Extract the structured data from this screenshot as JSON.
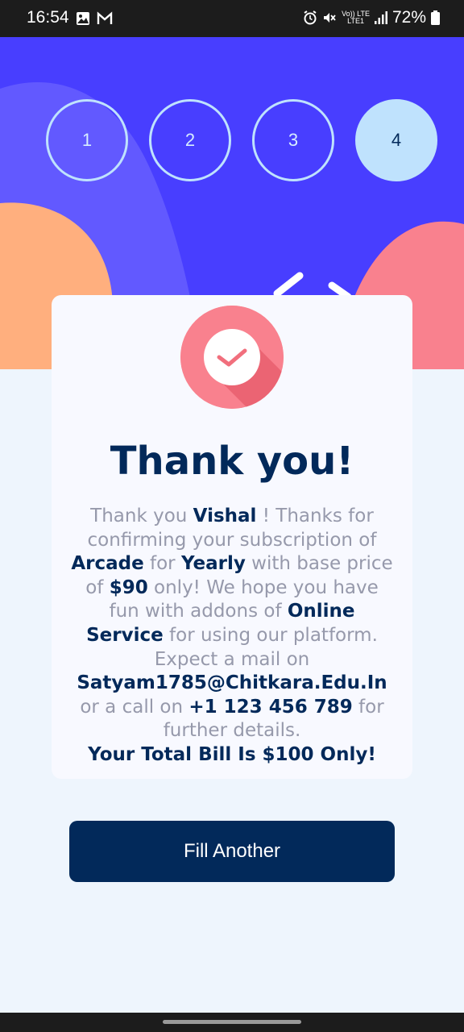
{
  "status_bar": {
    "time": "16:54",
    "battery": "72%",
    "network_top": "Vo)) LTE",
    "network_bottom": "LTE1",
    "icons": [
      "image-icon",
      "gmail-icon",
      "alarm-icon",
      "mute-icon",
      "signal-icon",
      "battery-icon"
    ]
  },
  "steps": [
    {
      "label": "1",
      "active": false
    },
    {
      "label": "2",
      "active": false
    },
    {
      "label": "3",
      "active": false
    },
    {
      "label": "4",
      "active": true
    }
  ],
  "card": {
    "title": "Thank you!",
    "message": {
      "p1": "Thank you ",
      "name": "Vishal",
      "p2": " ! Thanks for confirming your subscription of ",
      "plan": "Arcade",
      "p3": " for ",
      "billing": "Yearly",
      "p4": " with base price of ",
      "price": "$90",
      "p5": " only! We hope you have fun with addons of ",
      "addons": "Online Service",
      "p6": " for using our platform.",
      "p7": "Expect a mail on ",
      "email": "Satyam1785@Chitkara.Edu.In",
      "p8": " or a call on ",
      "phone": "+1 123 456 789",
      "p9": " for further details.",
      "total": "Your Total Bill Is $100 Only!"
    }
  },
  "actions": {
    "fill_another": "Fill Another"
  },
  "colors": {
    "primary": "#483eff",
    "navy": "#02295a",
    "light_blue": "#bfe2fd",
    "coral": "#f9818e",
    "orange": "#ffaf7e",
    "gray_text": "#9699ab"
  }
}
